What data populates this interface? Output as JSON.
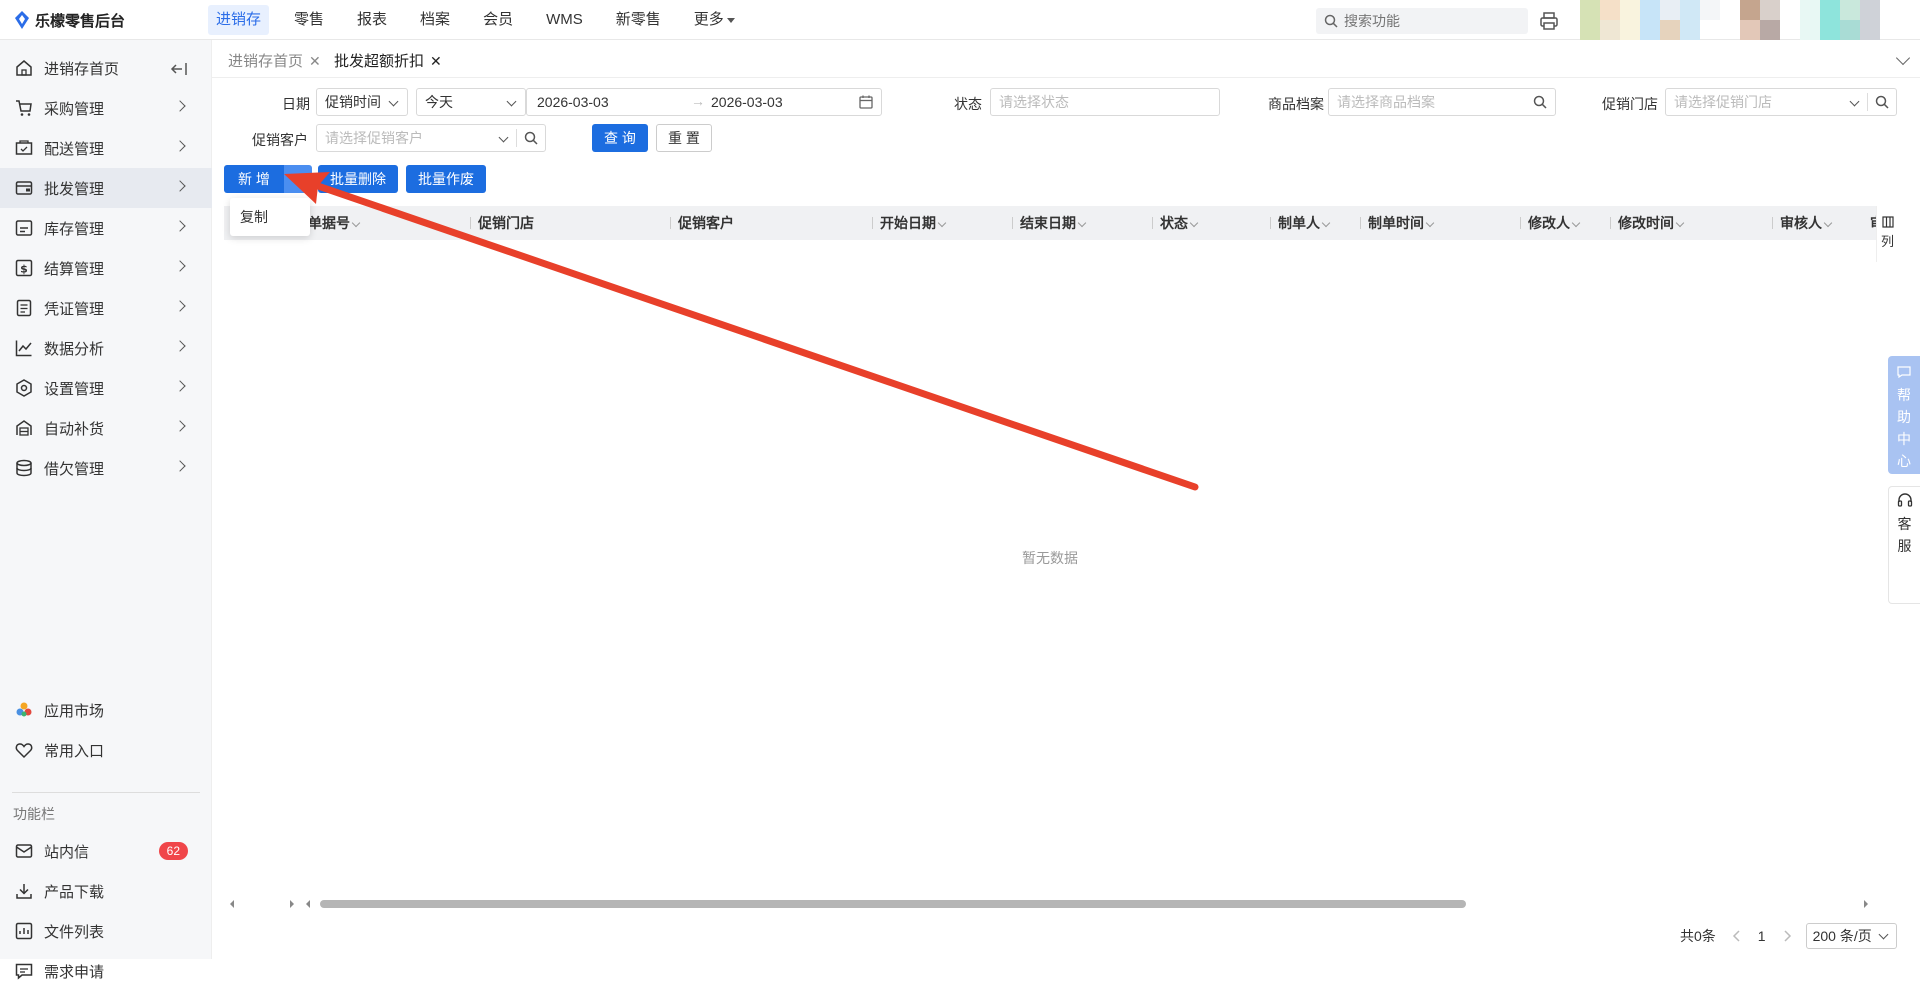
{
  "app": {
    "name": "乐檬零售后台"
  },
  "topnav": {
    "items": [
      "进销存",
      "零售",
      "报表",
      "档案",
      "会员",
      "WMS",
      "新零售",
      "更多"
    ],
    "active_index": 0
  },
  "search": {
    "placeholder": "搜索功能"
  },
  "sidebar": {
    "items": [
      {
        "label": "进销存首页",
        "icon": "home-icon"
      },
      {
        "label": "采购管理",
        "icon": "cart-icon"
      },
      {
        "label": "配送管理",
        "icon": "truck-icon"
      },
      {
        "label": "批发管理",
        "icon": "wallet-icon"
      },
      {
        "label": "库存管理",
        "icon": "warehouse-icon"
      },
      {
        "label": "结算管理",
        "icon": "dollar-icon"
      },
      {
        "label": "凭证管理",
        "icon": "document-icon"
      },
      {
        "label": "数据分析",
        "icon": "chart-icon"
      },
      {
        "label": "设置管理",
        "icon": "settings-icon"
      },
      {
        "label": "自动补货",
        "icon": "replenish-icon"
      },
      {
        "label": "借欠管理",
        "icon": "database-icon"
      }
    ],
    "active_index": 3,
    "bottom": [
      {
        "label": "应用市场",
        "icon": "app-market-icon"
      },
      {
        "label": "常用入口",
        "icon": "heart-icon"
      }
    ],
    "section_title": "功能栏",
    "functions": [
      {
        "label": "站内信",
        "icon": "mail-icon",
        "badge": "62"
      },
      {
        "label": "产品下载",
        "icon": "download-icon"
      },
      {
        "label": "文件列表",
        "icon": "file-list-icon"
      },
      {
        "label": "需求申请",
        "icon": "request-icon"
      }
    ]
  },
  "tabs": [
    {
      "label": "进销存首页",
      "active": false
    },
    {
      "label": "批发超额折扣",
      "active": true
    }
  ],
  "filters": {
    "date_label": "日期",
    "date_type": "促销时间",
    "date_range": "今天",
    "start_date": "2026-03-03",
    "range_sep": "→",
    "end_date": "2026-03-03",
    "status_label": "状态",
    "status_placeholder": "请选择状态",
    "product_label": "商品档案",
    "product_placeholder": "请选择商品档案",
    "store_label": "促销门店",
    "store_placeholder": "请选择促销门店",
    "customer_label": "促销客户",
    "customer_placeholder": "请选择促销客户",
    "query_button": "查 询",
    "reset_button": "重 置"
  },
  "actions": {
    "add": "新 增",
    "batch_delete": "批量删除",
    "batch_void": "批量作废",
    "dropdown_item": "复制"
  },
  "table": {
    "columns": [
      "单据号",
      "促销门店",
      "促销客户",
      "开始日期",
      "结束日期",
      "状态",
      "制单人",
      "制单时间",
      "修改人",
      "修改时间",
      "审核人",
      "审"
    ],
    "empty_text": "暂无数据",
    "column_setting": "列"
  },
  "pagination": {
    "total": "共0条",
    "current_page": "1",
    "page_size": "200 条/页"
  },
  "float": {
    "help_center": [
      "帮",
      "助",
      "中",
      "心"
    ],
    "service": [
      "客",
      "服"
    ]
  },
  "colors": {
    "primary": "#1c6de0",
    "annotation_arrow": "#e8402a",
    "badge": "#f0464a"
  }
}
